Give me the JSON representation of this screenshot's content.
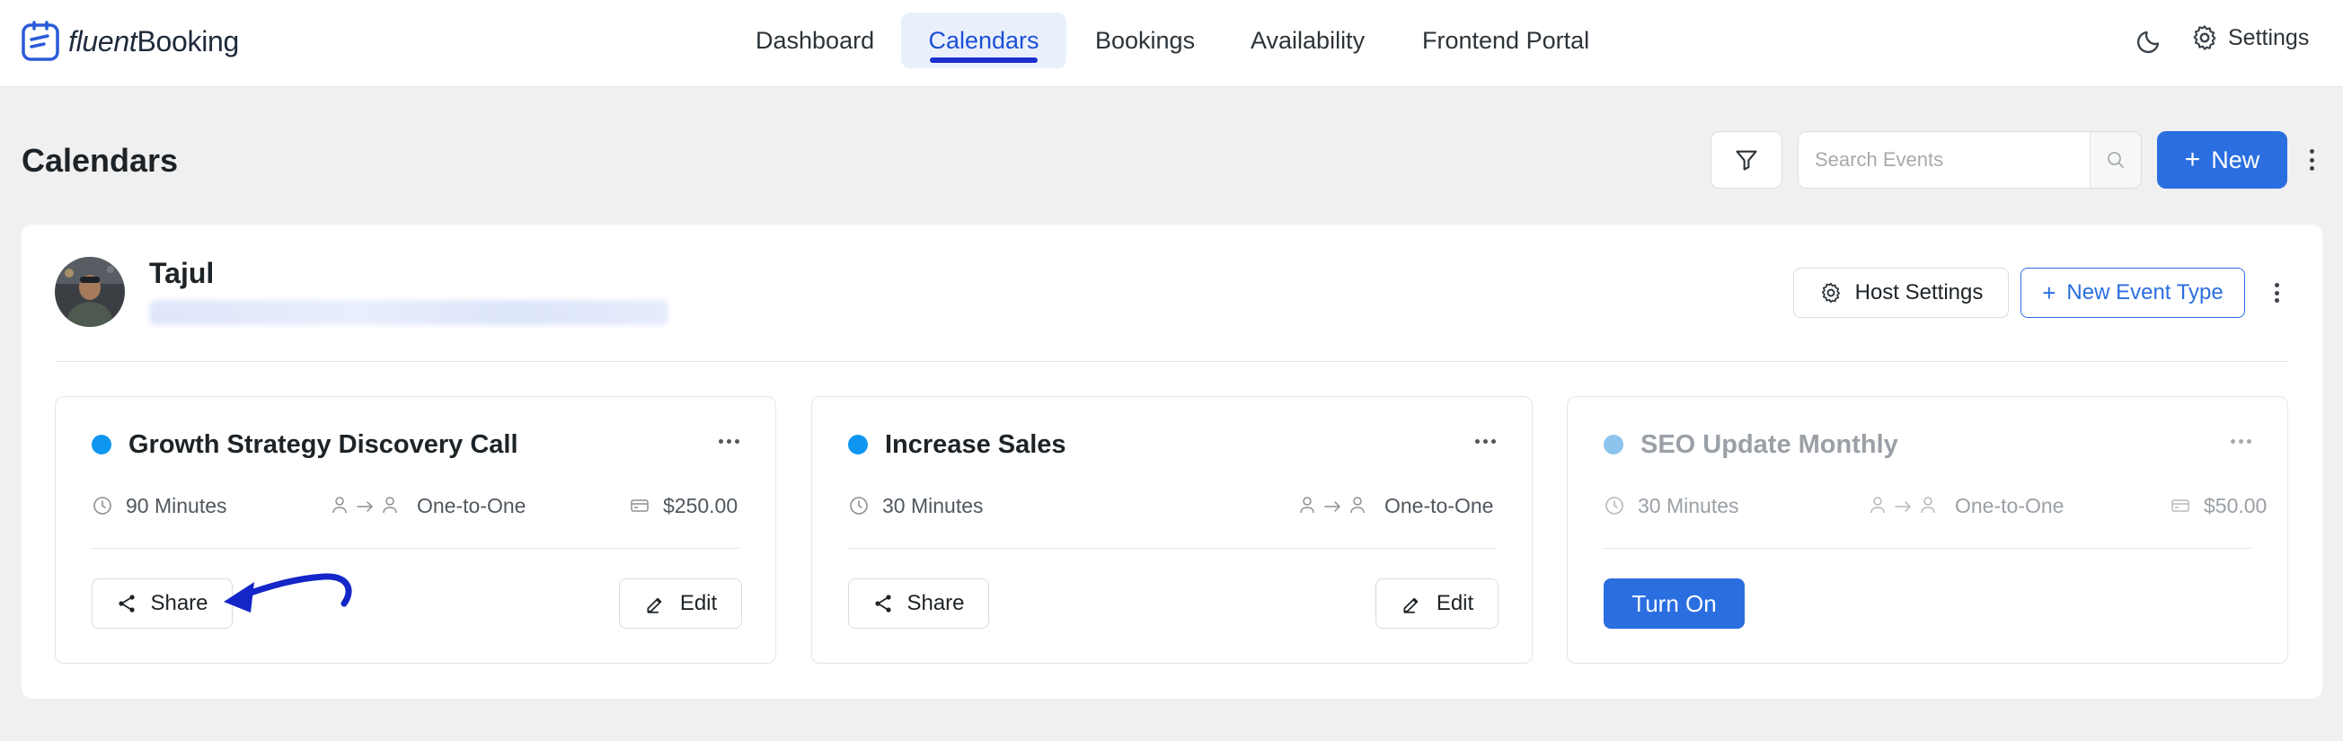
{
  "brand": {
    "logo_prefix": "fluent",
    "logo_suffix": "Booking"
  },
  "nav": {
    "items": [
      {
        "label": "Dashboard",
        "active": false
      },
      {
        "label": "Calendars",
        "active": true
      },
      {
        "label": "Bookings",
        "active": false
      },
      {
        "label": "Availability",
        "active": false
      },
      {
        "label": "Frontend Portal",
        "active": false
      }
    ],
    "settings_label": "Settings",
    "theme_icon": "moon-icon"
  },
  "page": {
    "title": "Calendars",
    "search_placeholder": "Search Events",
    "new_label": "New"
  },
  "host": {
    "name": "Tajul",
    "host_settings_label": "Host Settings",
    "new_event_type_label": "New Event Type"
  },
  "events": [
    {
      "title": "Growth Strategy Discovery Call",
      "duration": "90 Minutes",
      "type": "One-to-One",
      "price": "$250.00",
      "status": "active",
      "share_label": "Share",
      "edit_label": "Edit",
      "dot_color": "#0e96f0"
    },
    {
      "title": "Increase Sales",
      "duration": "30 Minutes",
      "type": "One-to-One",
      "price": "",
      "status": "active",
      "share_label": "Share",
      "edit_label": "Edit",
      "dot_color": "#0e96f0"
    },
    {
      "title": "SEO Update Monthly",
      "duration": "30 Minutes",
      "type": "One-to-One",
      "price": "$50.00",
      "status": "inactive",
      "turn_on_label": "Turn On",
      "dot_color": "#8cc4ee"
    }
  ],
  "colors": {
    "primary": "#2a6ee0",
    "nav_active_text": "#1c4fd6",
    "nav_active_bg": "#eaf0fb",
    "annotation_arrow": "#1426c8"
  }
}
